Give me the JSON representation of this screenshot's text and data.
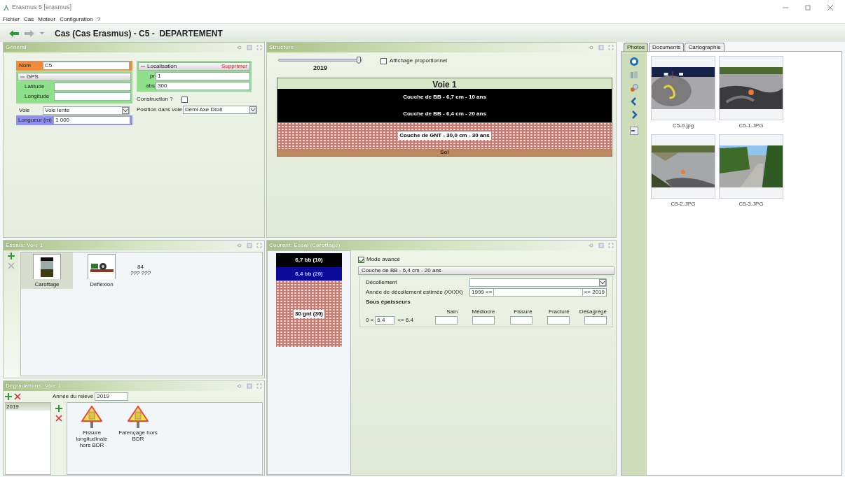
{
  "window": {
    "title": "Erasmus 5 [erasmus]"
  },
  "menu": [
    "Fichier",
    "Cas",
    "Moteur",
    "Configuration",
    "?"
  ],
  "nav": {
    "title": "Cas (Cas Erasmus) - C5 -  DEPARTEMENT"
  },
  "general": {
    "title": "Général",
    "nom_label": "Nom",
    "nom_value": "C5",
    "gps_label": "GPS",
    "latitude_label": "Latitude",
    "longitude_label": "Longitude",
    "voie_label": "Voie",
    "voie_value": "Voie lente",
    "longueur_label": "Longueur (m)",
    "longueur_value": "1 000",
    "localisation_label": "Localisation",
    "supprimer": "Supprimer",
    "pr_label": "pr",
    "pr_value": "1",
    "abs_label": "abs",
    "abs_value": "300",
    "construction_label": "Construction ?",
    "construction_checked": false,
    "position_label": "Position dans voie",
    "position_value": "Demi Axe Droit"
  },
  "structure": {
    "title": "Structure",
    "slider": {
      "level": 0.97
    },
    "year": "2019",
    "proportional": {
      "label": "Affichage proportionnel",
      "checked": false
    },
    "lane_title": "Voie 1",
    "layers": [
      {
        "kind": "bitumen",
        "label": "Couche de BB - 6,7 cm - 10 ans"
      },
      {
        "kind": "bitumen",
        "label": "Couche de BB - 6,4 cm - 20 ans"
      },
      {
        "kind": "gravel",
        "label": "Couche de GNT - 30,0 cm - 30 ans"
      },
      {
        "kind": "soil",
        "label": "Sol"
      }
    ]
  },
  "essais": {
    "title": "Essais: Voie 1",
    "items": [
      {
        "kind": "core",
        "label": "Carottage",
        "selected": true
      },
      {
        "kind": "deflection",
        "label": "Déflexion",
        "selected": false,
        "note": "84",
        "subnote": "??? ???"
      }
    ]
  },
  "degradations": {
    "title": "Dégradations: Voie 1",
    "years": [
      {
        "label": "2019",
        "selected": true
      }
    ],
    "year_label": "Année du relevé",
    "year_value": "2019",
    "items": [
      {
        "label": "Fissure longitudinale hors BDR"
      },
      {
        "label": "Faïençage hors BDR"
      }
    ]
  },
  "courant": {
    "title": "Courant: Essai (Carottage)",
    "core": [
      {
        "kind": "black",
        "label": "6,7 bb (10)"
      },
      {
        "kind": "blue",
        "label": "6,4 bb (20)"
      },
      {
        "kind": "gravel",
        "label": "30 gnt (30)"
      }
    ],
    "mode_avance": {
      "label": "Mode avancé",
      "checked": true
    },
    "layer_header": "Couche de BB - 6,4 cm - 20 ans",
    "decollement_label": "Décollement",
    "annee_label": "Année de décollement estimée (XXXX)",
    "annee_min": "1999 <=",
    "annee_max": "<= 2019",
    "sous_title": "Sous épaisseurs",
    "columns": [
      "Sain",
      "Médiocre",
      "Fissuré",
      "Fracturé",
      "Désagrégé"
    ],
    "range_prefix": "0 <",
    "range_value": "6.4",
    "range_suffix": "<= 6.4"
  },
  "photos": {
    "tabs": [
      {
        "label": "Photos",
        "selected": true
      },
      {
        "label": "Documents",
        "selected": false
      },
      {
        "label": "Cartographie",
        "selected": false
      }
    ],
    "items": [
      {
        "caption": "C5-0.jpg"
      },
      {
        "caption": "C5-1.JPG"
      },
      {
        "caption": "C5-2.JPG"
      },
      {
        "caption": "C5-3.JPG"
      }
    ]
  }
}
